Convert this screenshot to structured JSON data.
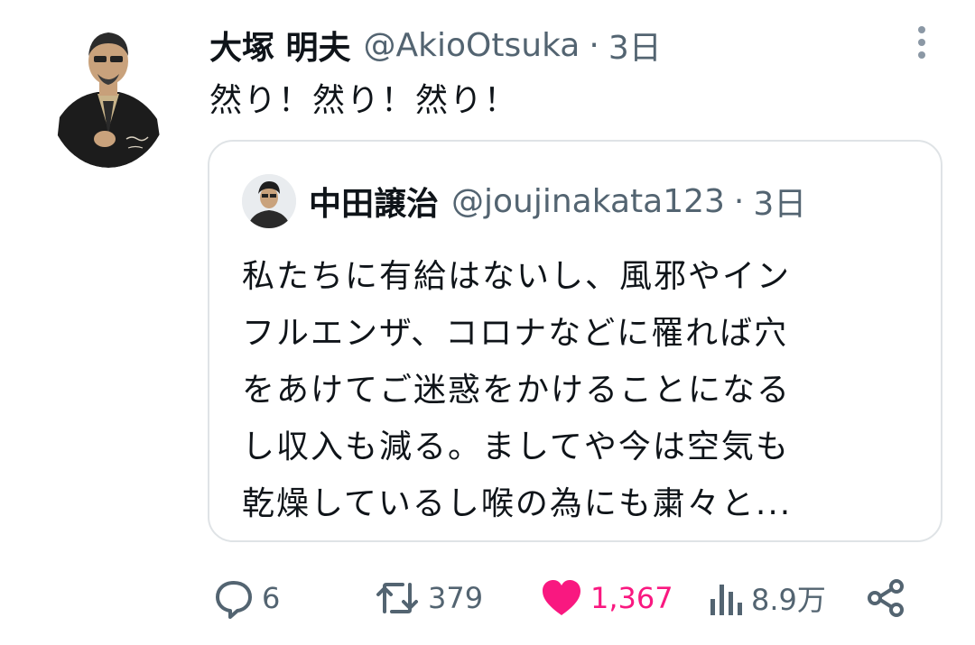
{
  "tweet": {
    "author_name": "大塚 明夫",
    "author_handle": "@AkioOtsuka",
    "separator": "·",
    "time": "3日",
    "text": "然り！然り！然り！"
  },
  "quoted": {
    "author_name": "中田譲治",
    "author_handle": "@joujinakata123",
    "separator": "·",
    "time": "3日",
    "lines": [
      "私たちに有給はないし、風邪やイン",
      "フルエンザ、コロナなどに罹れば穴",
      "をあけてご迷惑をかけることになる",
      "し収入も減る。ましてや今は空気も",
      "乾燥しているし喉の為にも粛々と..."
    ]
  },
  "actions": {
    "replies": "6",
    "retweets": "379",
    "likes": "1,367",
    "views": "8.9万"
  },
  "colors": {
    "text": "#0f1419",
    "secondary": "#536471",
    "like": "#f91880",
    "border": "#dfe3e6"
  },
  "icons": {
    "reply": "reply-icon",
    "retweet": "retweet-icon",
    "like": "heart-icon",
    "views": "views-icon",
    "share": "share-icon",
    "more": "more-vertical-icon"
  }
}
